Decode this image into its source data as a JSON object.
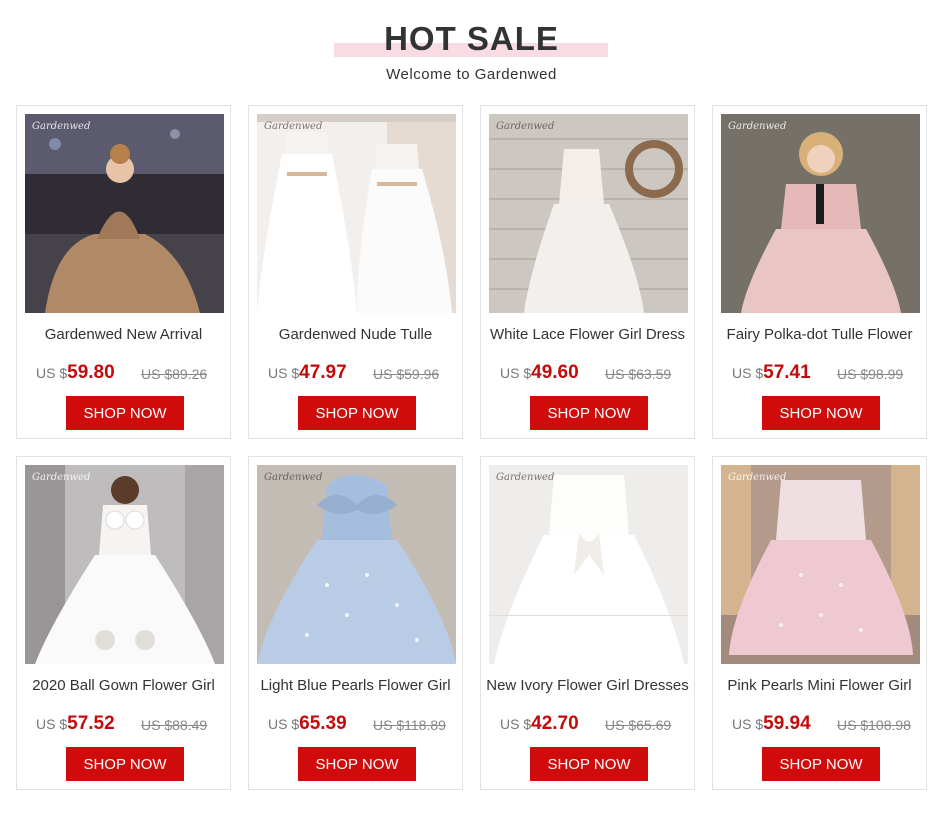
{
  "header": {
    "title": "HOT SALE",
    "subtitle": "Welcome to Gardenwed"
  },
  "watermark": "Gardenwed",
  "colors": {
    "accent_bar": "#f8dbe3",
    "price_red": "#c30b0b",
    "button_red": "#d00b0b"
  },
  "currency_label": "US $",
  "products": [
    {
      "name": "Gardenwed New Arrival",
      "price": "59.80",
      "old_price": "US $89.26",
      "button": "SHOP NOW",
      "image": "champagne-sequin-ball-gown-photo"
    },
    {
      "name": "Gardenwed Nude Tulle",
      "price": "47.97",
      "old_price": "US $59.96",
      "button": "SHOP NOW",
      "image": "two-white-tulle-dresses-on-hangers-photo"
    },
    {
      "name": "White Lace Flower Girl Dress",
      "price": "49.60",
      "old_price": "US $63.59",
      "button": "SHOP NOW",
      "image": "white-lace-dress-on-wood-wall-photo"
    },
    {
      "name": "Fairy Polka-dot Tulle Flower",
      "price": "57.41",
      "old_price": "US $98.99",
      "button": "SHOP NOW",
      "image": "pink-polka-dot-dress-girl-photo"
    },
    {
      "name": "2020 Ball Gown Flower Girl",
      "price": "57.52",
      "old_price": "US $88.49",
      "button": "SHOP NOW",
      "image": "white-ball-gown-bow-back-photo"
    },
    {
      "name": "Light Blue Pearls Flower Girl",
      "price": "65.39",
      "old_price": "US $118.89",
      "button": "SHOP NOW",
      "image": "light-blue-pearl-dress-photo"
    },
    {
      "name": "New Ivory Flower Girl Dresses",
      "price": "42.70",
      "old_price": "US $65.69",
      "button": "SHOP NOW",
      "image": "ivory-dress-with-sash-photo"
    },
    {
      "name": "Pink Pearls Mini Flower Girl",
      "price": "59.94",
      "old_price": "US $108.98",
      "button": "SHOP NOW",
      "image": "pink-pearl-mini-dress-photo"
    }
  ]
}
